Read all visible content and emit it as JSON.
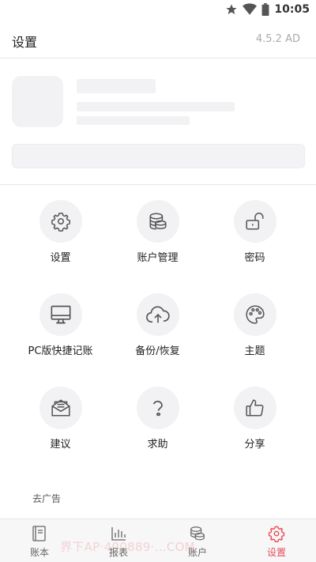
{
  "status_bar": {
    "time": "10:05"
  },
  "header": {
    "title": "设置",
    "version": "4.5.2 AD"
  },
  "grid": [
    {
      "label": "设置",
      "icon": "gear-icon"
    },
    {
      "label": "账户管理",
      "icon": "coins-icon"
    },
    {
      "label": "密码",
      "icon": "unlock-icon"
    },
    {
      "label": "PC版快捷记账",
      "icon": "monitor-icon"
    },
    {
      "label": "备份/恢复",
      "icon": "cloud-upload-icon"
    },
    {
      "label": "主题",
      "icon": "palette-icon"
    },
    {
      "label": "建议",
      "icon": "mail-icon"
    },
    {
      "label": "求助",
      "icon": "help-icon"
    },
    {
      "label": "分享",
      "icon": "thumbs-up-icon"
    }
  ],
  "ads": {
    "label": "去广告"
  },
  "bottom_nav": [
    {
      "label": "账本",
      "icon": "book-icon",
      "active": false
    },
    {
      "label": "报表",
      "icon": "bar-chart-icon",
      "active": false
    },
    {
      "label": "账户",
      "icon": "coins-icon",
      "active": false
    },
    {
      "label": "设置",
      "icon": "gear-icon",
      "active": true
    }
  ],
  "watermark": "界下AP·400889·...COM",
  "colors": {
    "active": "#e74c55",
    "inactive": "#888888",
    "icon_stroke": "#555555"
  }
}
